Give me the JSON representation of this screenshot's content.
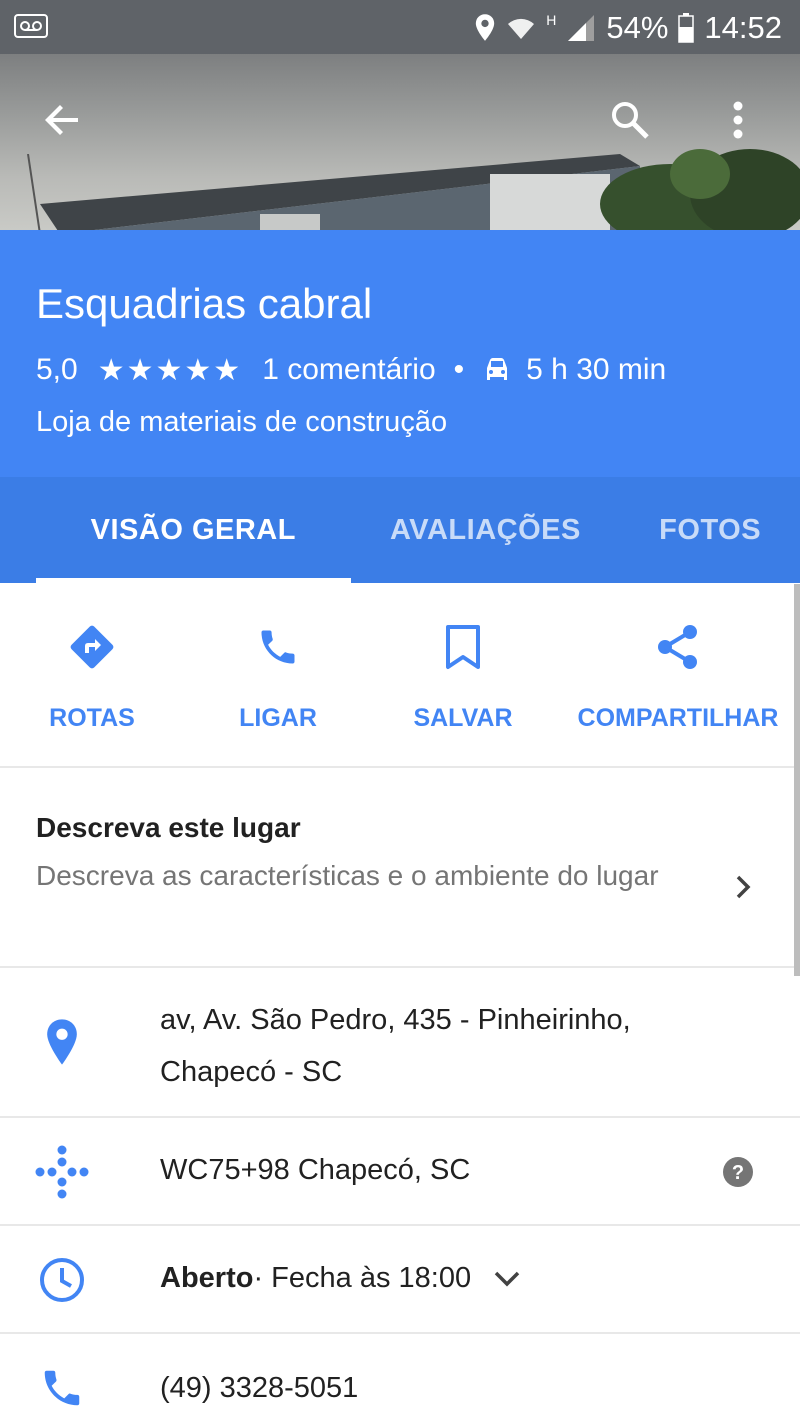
{
  "status_bar": {
    "battery": "54%",
    "time": "14:52",
    "network": "H",
    "icons": [
      "voicemail-icon",
      "location-icon",
      "wifi-icon",
      "signal-icon",
      "battery-icon"
    ]
  },
  "header": {
    "back_icon": "arrow-back-icon",
    "search_icon": "search-icon",
    "more_icon": "more-vert-icon"
  },
  "place": {
    "name": "Esquadrias cabral",
    "rating": "5,0",
    "stars": "★★★★★",
    "reviews": "1 comentário",
    "separator": "•",
    "drive_time": "5 h 30 min",
    "category": "Loja de materiais de construção"
  },
  "tabs": [
    {
      "label": "VISÃO GERAL",
      "active": true
    },
    {
      "label": "AVALIAÇÕES",
      "active": false
    },
    {
      "label": "FOTOS",
      "active": false
    }
  ],
  "actions": [
    {
      "label": "ROTAS",
      "icon": "directions-icon"
    },
    {
      "label": "LIGAR",
      "icon": "phone-icon"
    },
    {
      "label": "SALVAR",
      "icon": "bookmark-icon"
    },
    {
      "label": "COMPARTILHAR",
      "icon": "share-icon"
    }
  ],
  "describe": {
    "title": "Descreva este lugar",
    "subtitle": "Descreva as características e o ambiente do lugar"
  },
  "info": {
    "address": "av, Av. São Pedro, 435 - Pinheirinho, Chapecó - SC",
    "plus_code": "WC75+98 Chapecó, SC",
    "hours_status": "Aberto",
    "hours_detail": " · Fecha às 18:00",
    "phone": "(49) 3328-5051"
  },
  "colors": {
    "accent": "#4285f4",
    "tabs_bg": "#3b7de6",
    "status_bar": "#5f6368"
  }
}
